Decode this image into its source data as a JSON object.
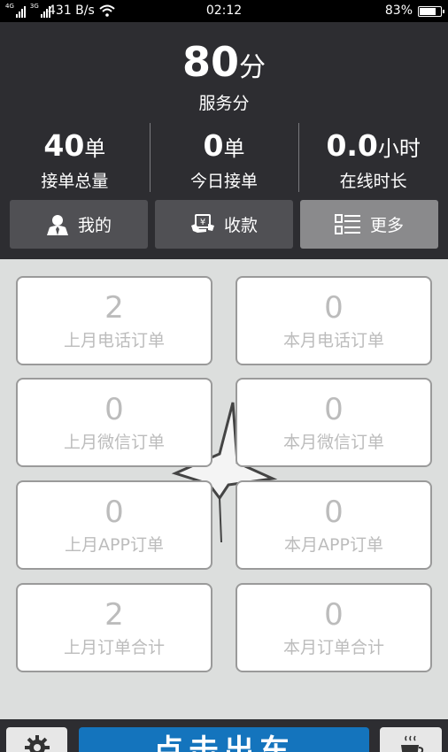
{
  "status_bar": {
    "network_tag_1": "4G",
    "network_tag_2": "3G",
    "speed": "431 B/s",
    "time": "02:12",
    "battery_pct": "83%",
    "battery_level": 0.83
  },
  "header": {
    "score_value": "80",
    "score_unit": "分",
    "score_label": "服务分",
    "stats": [
      {
        "value": "40",
        "unit": "单",
        "label": "接单总量"
      },
      {
        "value": "0",
        "unit": "单",
        "label": "今日接单"
      },
      {
        "value": "0.0",
        "unit": "小时",
        "label": "在线时长"
      }
    ],
    "nav": {
      "mine": "我的",
      "pay": "收款",
      "more": "更多"
    }
  },
  "orders": [
    {
      "value": "2",
      "label": "上月电话订单"
    },
    {
      "value": "0",
      "label": "本月电话订单"
    },
    {
      "value": "0",
      "label": "上月微信订单"
    },
    {
      "value": "0",
      "label": "本月微信订单"
    },
    {
      "value": "0",
      "label": "上月APP订单"
    },
    {
      "value": "0",
      "label": "本月APP订单"
    },
    {
      "value": "2",
      "label": "上月订单合计"
    },
    {
      "value": "0",
      "label": "本月订单合计"
    }
  ],
  "footer": {
    "start_label": "点击出车",
    "settings_icon": "gear-icon",
    "cup_icon": "coffee-cup-icon"
  },
  "colors": {
    "header_bg": "#2d2d31",
    "accent_blue": "#1474bd",
    "content_bg": "#dcdedd"
  }
}
